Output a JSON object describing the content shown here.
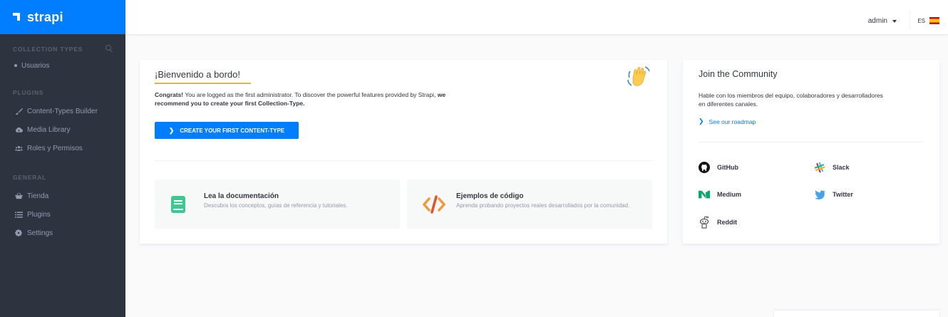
{
  "brand": {
    "name": "strapi"
  },
  "sidebar": {
    "collection_types_label": "COLLECTION TYPES",
    "collection_items": [
      {
        "label": "Usuarios"
      }
    ],
    "plugins_label": "PLUGINS",
    "plugin_items": [
      {
        "label": "Content-Types Builder",
        "icon": "paint-brush-icon"
      },
      {
        "label": "Media Library",
        "icon": "cloud-upload-icon"
      },
      {
        "label": "Roles y Permisos",
        "icon": "users-icon"
      }
    ],
    "general_label": "GENERAL",
    "general_items": [
      {
        "label": "Tienda",
        "icon": "shopping-basket-icon"
      },
      {
        "label": "Plugins",
        "icon": "list-icon"
      },
      {
        "label": "Settings",
        "icon": "gear-icon"
      }
    ]
  },
  "header": {
    "user": "admin",
    "language": "ES"
  },
  "welcome": {
    "title": "¡Bienvenido a bordo!",
    "congrats": "Congrats!",
    "text1": " You are logged as the first administrator. To discover the powerful features provided by Strapi, ",
    "text_bold": "we recommend you to create your first Collection-Type.",
    "cta_label": "CREATE YOUR FIRST CONTENT-TYPE",
    "tiles": [
      {
        "title": "Lea la documentación",
        "subtitle": "Descubra los conceptos, guías de referencia y tutoriales."
      },
      {
        "title": "Ejemplos de código",
        "subtitle": "Aprenda probando proyectos reales desarrollados por la comunidad."
      }
    ]
  },
  "community": {
    "title": "Join the Community",
    "text": "Hable con los miembros del equipo, colaboradores y desarrolladores en diferentes canales.",
    "roadmap_label": "See our roadmap",
    "links": [
      {
        "label": "GitHub"
      },
      {
        "label": "Slack"
      },
      {
        "label": "Medium"
      },
      {
        "label": "Twitter"
      },
      {
        "label": "Reddit"
      }
    ]
  },
  "colors": {
    "accent": "#007eff",
    "sidebar": "#2e3340",
    "underline": "#f0b41e",
    "doc_icon": "#3ec791",
    "code_icon": "#f29a3a"
  }
}
